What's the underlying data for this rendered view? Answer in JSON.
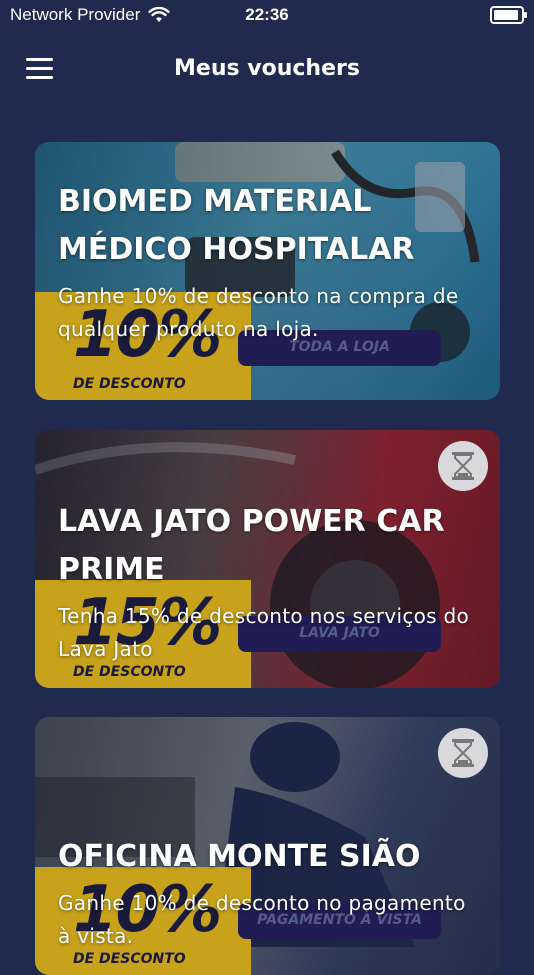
{
  "status": {
    "carrier": "Network Provider",
    "time": "22:36",
    "battery_level": 1.0
  },
  "header": {
    "title": "Meus vouchers",
    "menu_icon": "hamburger-icon"
  },
  "vouchers": [
    {
      "title": "BIOMED MATERIAL MÉDICO HOSPITALAR",
      "description": "Ganhe 10% de desconto na compra de qualquer produto na loja.",
      "badge_percent": "10%",
      "badge_label": "DE DESCONTO",
      "pill_label": "TODA A LOJA",
      "expired": false
    },
    {
      "title": "LAVA JATO POWER CAR PRIME",
      "description": "Tenha 15% de desconto nos serviços do Lava Jato",
      "badge_percent": "15%",
      "badge_label": "DE DESCONTO",
      "pill_label": "LAVA JATO",
      "expired": true,
      "status_icon": "hourglass-icon"
    },
    {
      "title": "OFICINA MONTE SIÃO",
      "description": "Ganhe 10% de desconto no pagamento à vista.",
      "badge_percent": "10%",
      "badge_label": "DE DESCONTO",
      "pill_label": "PAGAMENTO À VISTA",
      "expired": true,
      "status_icon": "hourglass-icon"
    }
  ],
  "colors": {
    "background": "#1f2a4e",
    "badge": "#c9a21b",
    "pill": "#221c55"
  }
}
